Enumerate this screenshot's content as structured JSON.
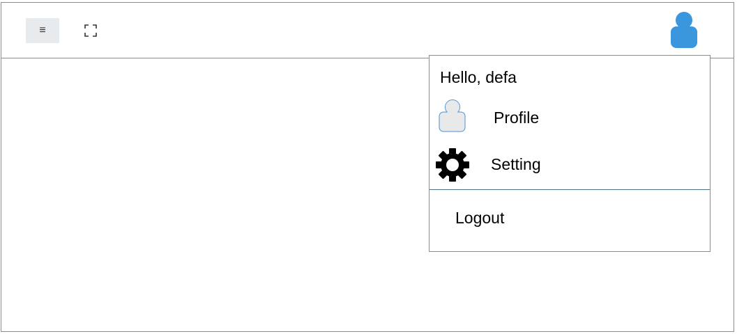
{
  "topbar": {
    "menu_icon": "hamburger-icon",
    "menu_glyph": "≡",
    "fullscreen_icon": "fullscreen-icon",
    "avatar_icon": "user-avatar-icon",
    "avatar_color": "#3a97dd"
  },
  "user_menu": {
    "greeting": "Hello, defa",
    "items": [
      {
        "label": "Profile",
        "icon": "user-icon"
      },
      {
        "label": "Setting",
        "icon": "gear-icon"
      },
      {
        "label": "Logout"
      }
    ]
  }
}
